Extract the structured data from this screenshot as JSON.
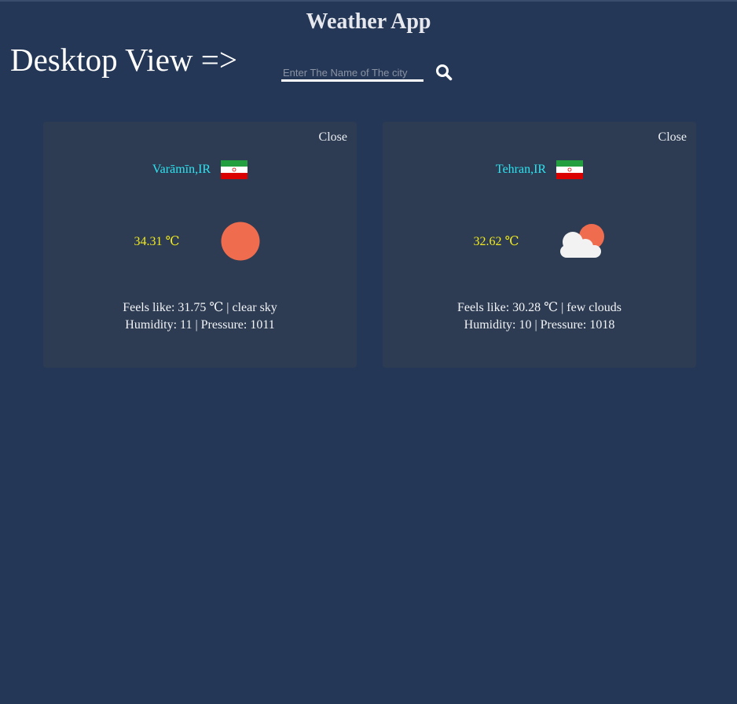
{
  "app": {
    "title": "Weather App",
    "view_label": "Desktop View =>"
  },
  "search": {
    "placeholder": "Enter The Name of The city",
    "value": "",
    "icon": "search-icon"
  },
  "cards": [
    {
      "close_label": "Close",
      "city": "Varāmīn,IR",
      "flag": "iran-flag-icon",
      "temperature": "34.31 ℃",
      "weather_icon": "clear-sky-sun-icon",
      "feels_line": "Feels like: 31.75 ℃ | clear sky",
      "stats_line": "Humidity: 11 | Pressure: 1011"
    },
    {
      "close_label": "Close",
      "city": "Tehran,IR",
      "flag": "iran-flag-icon",
      "temperature": "32.62 ℃",
      "weather_icon": "few-clouds-icon",
      "feels_line": "Feels like: 30.28 ℃ | few clouds",
      "stats_line": "Humidity: 10 | Pressure: 1018"
    }
  ],
  "colors": {
    "background": "#253756",
    "card": "#2d3c52",
    "city": "#2ee3f0",
    "temperature": "#f2ea1e",
    "sun": "#ef6c4e"
  }
}
